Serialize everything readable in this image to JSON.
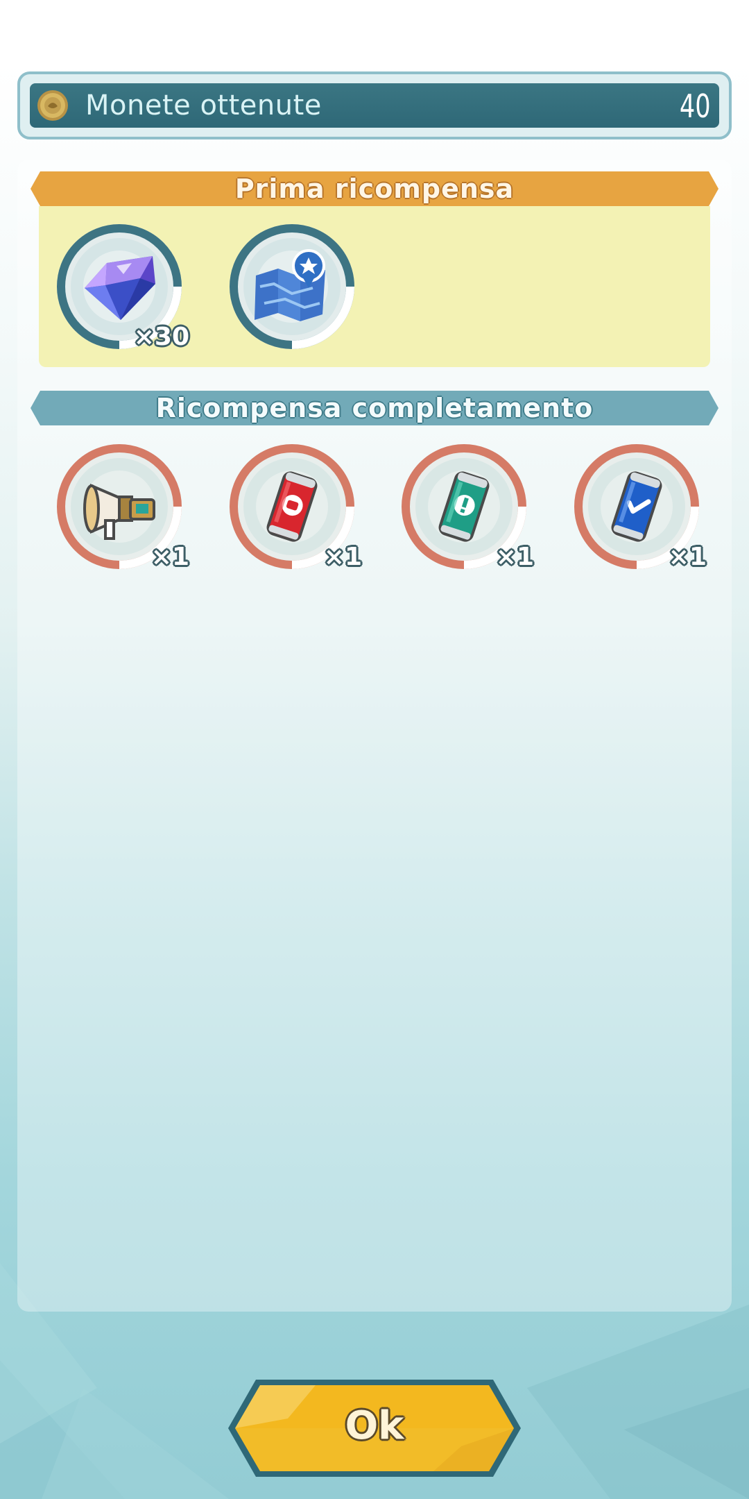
{
  "coins": {
    "label": "Monete ottenute",
    "value": "40",
    "icon": "coin-icon"
  },
  "first_reward": {
    "title": "Prima ricompensa",
    "items": [
      {
        "icon": "crystal-icon",
        "quantity": "×30"
      },
      {
        "icon": "map-icon",
        "quantity": ""
      }
    ]
  },
  "completion_reward": {
    "title": "Ricompensa completamento",
    "items": [
      {
        "icon": "megaphone-icon",
        "quantity": "×1"
      },
      {
        "icon": "red-can-icon",
        "quantity": "×1"
      },
      {
        "icon": "green-can-icon",
        "quantity": "×1"
      },
      {
        "icon": "blue-can-icon",
        "quantity": "×1"
      }
    ]
  },
  "ok_button": {
    "label": "Ok"
  },
  "colors": {
    "header_bar": "#2e6877",
    "first_banner": "#e7a441",
    "first_box": "#f3f2b4",
    "completion_banner": "#72aab8",
    "ok_button": "#f3b81f"
  }
}
